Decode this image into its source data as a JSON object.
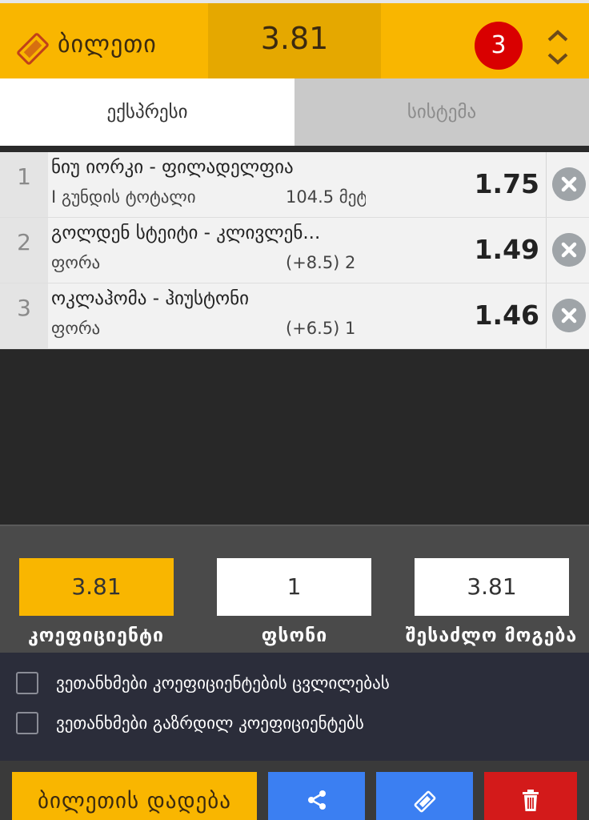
{
  "header": {
    "title": "ბილეთი",
    "total_odds": "3.81",
    "count": "3",
    "ticket_icon": "ticket-icon",
    "toggle_icon": "chevron-up-down-icon"
  },
  "tabs": [
    {
      "label": "ექსპრესი",
      "active": true
    },
    {
      "label": "სისტემა",
      "active": false
    }
  ],
  "bets": [
    {
      "num": "1",
      "match": "ნიუ იორკი - ფილადელფია",
      "market": "I გუნდის ტოტალი",
      "selection": "104.5 მეტი",
      "odds": "1.75"
    },
    {
      "num": "2",
      "match": "გოლდენ სტეიტი - კლივლენ...",
      "market": "ფორა",
      "selection": "(+8.5) 2",
      "odds": "1.49"
    },
    {
      "num": "3",
      "match": "ოკლაჰომა - ჰიუსტონი",
      "market": "ფორა",
      "selection": "(+6.5) 1",
      "odds": "1.46"
    }
  ],
  "totals": {
    "odds_value": "3.81",
    "odds_label": "კოეფიციენტი",
    "stake_value": "1",
    "stake_label": "ფსონი",
    "win_value": "3.81",
    "win_label": "შესაძლო მოგება"
  },
  "checks": {
    "accept_changes": "ვეთანხმები კოეფიციენტების ცვლილებას",
    "accept_boosted": "ვეთანხმები გაზრდილ კოეფიციენტებს"
  },
  "actions": {
    "place_label": "ბილეთის დადება",
    "share_icon": "share-icon",
    "ticket_icon": "ticket-icon",
    "trash_icon": "trash-icon"
  },
  "colors": {
    "accent": "#f9b600",
    "badge": "#d90000",
    "blue": "#3b7ff2",
    "red": "#d31a1a"
  }
}
